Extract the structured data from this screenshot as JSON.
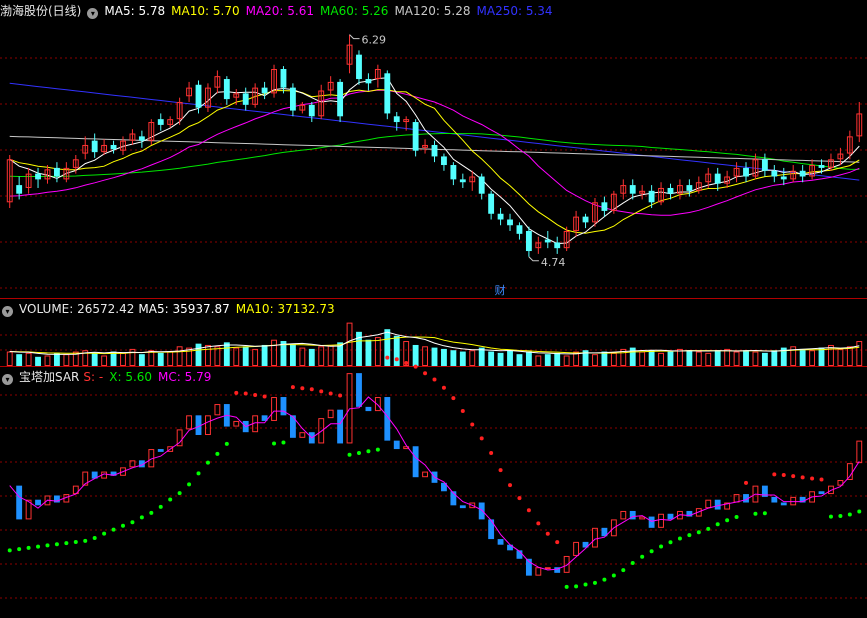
{
  "colors": {
    "up": "#ff3232",
    "down": "#54ffff",
    "bg": "#000000",
    "grid": "#8b0000",
    "ma5": "#ffffff",
    "ma10": "#ffff00",
    "ma20": "#ff00ff",
    "ma60": "#00e600",
    "ma120": "#c8c8c8",
    "ma250": "#3232ff",
    "sarUp": "#00ff00",
    "sarDown": "#ff2020",
    "mc": "#ff00ff",
    "blue": "#1e90ff"
  },
  "panel1": {
    "title": "渤海股份(日线)",
    "ma5": {
      "label": "MA5:",
      "value": "5.78"
    },
    "ma10": {
      "label": "MA10:",
      "value": "5.70"
    },
    "ma20": {
      "label": "MA20:",
      "value": "5.61"
    },
    "ma60": {
      "label": "MA60:",
      "value": "5.26"
    },
    "ma120": {
      "label": "MA120:",
      "value": "5.28"
    },
    "ma250": {
      "label": "MA250:",
      "value": "5.34"
    },
    "high_label": "6.29",
    "low_label": "4.74",
    "marker_label": "财"
  },
  "panel2": {
    "title": "VOLUME:",
    "value": "26572.42",
    "ma5": {
      "label": "MA5:",
      "value": "35937.87"
    },
    "ma10": {
      "label": "MA10:",
      "value": "37132.73"
    }
  },
  "panel3": {
    "title": "宝塔加SAR",
    "s": {
      "label": "S:",
      "value": "-"
    },
    "x": {
      "label": "X:",
      "value": "5.60"
    },
    "mc": {
      "label": "MC:",
      "value": "5.79"
    }
  },
  "chart_data": {
    "type": "candlestick",
    "price_range": [
      4.55,
      6.35
    ],
    "candles": [
      [
        5.12,
        5.42,
        5.08,
        5.45
      ],
      [
        5.24,
        5.18,
        5.14,
        5.3
      ],
      [
        5.22,
        5.32,
        5.18,
        5.36
      ],
      [
        5.32,
        5.28,
        5.22,
        5.36
      ],
      [
        5.28,
        5.35,
        5.25,
        5.38
      ],
      [
        5.36,
        5.3,
        5.26,
        5.4
      ],
      [
        5.28,
        5.36,
        5.26,
        5.4
      ],
      [
        5.36,
        5.42,
        5.32,
        5.45
      ],
      [
        5.46,
        5.52,
        5.42,
        5.58
      ],
      [
        5.55,
        5.47,
        5.43,
        5.6
      ],
      [
        5.47,
        5.52,
        5.45,
        5.56
      ],
      [
        5.52,
        5.49,
        5.46,
        5.55
      ],
      [
        5.48,
        5.55,
        5.45,
        5.58
      ],
      [
        5.55,
        5.6,
        5.52,
        5.63
      ],
      [
        5.58,
        5.55,
        5.5,
        5.62
      ],
      [
        5.55,
        5.68,
        5.52,
        5.7
      ],
      [
        5.7,
        5.66,
        5.62,
        5.74
      ],
      [
        5.66,
        5.7,
        5.64,
        5.72
      ],
      [
        5.7,
        5.82,
        5.66,
        5.85
      ],
      [
        5.86,
        5.92,
        5.82,
        5.96
      ],
      [
        5.94,
        5.78,
        5.74,
        5.97
      ],
      [
        5.78,
        5.92,
        5.75,
        5.95
      ],
      [
        5.92,
        6.0,
        5.88,
        6.04
      ],
      [
        5.98,
        5.84,
        5.8,
        6.0
      ],
      [
        5.85,
        5.88,
        5.8,
        5.91
      ],
      [
        5.88,
        5.8,
        5.76,
        5.92
      ],
      [
        5.8,
        5.92,
        5.78,
        5.95
      ],
      [
        5.92,
        5.88,
        5.84,
        5.96
      ],
      [
        5.88,
        6.05,
        5.85,
        6.08
      ],
      [
        6.05,
        5.92,
        5.88,
        6.07
      ],
      [
        5.92,
        5.76,
        5.72,
        5.95
      ],
      [
        5.76,
        5.8,
        5.74,
        5.82
      ],
      [
        5.8,
        5.72,
        5.68,
        5.82
      ],
      [
        5.72,
        5.9,
        5.7,
        5.94
      ],
      [
        5.9,
        5.96,
        5.86,
        6.0
      ],
      [
        5.96,
        5.72,
        5.68,
        5.98
      ],
      [
        6.08,
        6.22,
        6.02,
        6.29
      ],
      [
        6.15,
        5.98,
        5.94,
        6.18
      ],
      [
        5.98,
        5.95,
        5.9,
        6.02
      ],
      [
        5.98,
        6.05,
        5.92,
        6.08
      ],
      [
        6.02,
        5.74,
        5.7,
        6.04
      ],
      [
        5.72,
        5.68,
        5.62,
        5.75
      ],
      [
        5.68,
        5.7,
        5.62,
        5.72
      ],
      [
        5.68,
        5.48,
        5.44,
        5.7
      ],
      [
        5.5,
        5.52,
        5.46,
        5.56
      ],
      [
        5.52,
        5.44,
        5.4,
        5.55
      ],
      [
        5.44,
        5.38,
        5.34,
        5.46
      ],
      [
        5.38,
        5.28,
        5.24,
        5.4
      ],
      [
        5.28,
        5.26,
        5.22,
        5.32
      ],
      [
        5.26,
        5.3,
        5.2,
        5.34
      ],
      [
        5.3,
        5.18,
        5.14,
        5.32
      ],
      [
        5.18,
        5.04,
        5.0,
        5.2
      ],
      [
        5.04,
        5.0,
        4.96,
        5.08
      ],
      [
        5.0,
        4.96,
        4.92,
        5.04
      ],
      [
        4.96,
        4.9,
        4.86,
        4.98
      ],
      [
        4.92,
        4.78,
        4.74,
        4.95
      ],
      [
        4.8,
        4.84,
        4.76,
        4.88
      ],
      [
        4.86,
        4.84,
        4.8,
        4.92
      ],
      [
        4.84,
        4.8,
        4.76,
        4.88
      ],
      [
        4.8,
        4.92,
        4.78,
        4.95
      ],
      [
        4.92,
        5.02,
        4.88,
        5.06
      ],
      [
        5.02,
        4.98,
        4.94,
        5.04
      ],
      [
        4.98,
        5.12,
        4.95,
        5.15
      ],
      [
        5.12,
        5.06,
        5.02,
        5.16
      ],
      [
        5.06,
        5.18,
        5.04,
        5.2
      ],
      [
        5.18,
        5.24,
        5.14,
        5.28
      ],
      [
        5.24,
        5.18,
        5.14,
        5.28
      ],
      [
        5.18,
        5.2,
        5.14,
        5.24
      ],
      [
        5.2,
        5.12,
        5.08,
        5.24
      ],
      [
        5.12,
        5.22,
        5.1,
        5.26
      ],
      [
        5.22,
        5.18,
        5.14,
        5.25
      ],
      [
        5.18,
        5.24,
        5.14,
        5.28
      ],
      [
        5.24,
        5.2,
        5.16,
        5.28
      ],
      [
        5.2,
        5.26,
        5.18,
        5.3
      ],
      [
        5.26,
        5.32,
        5.22,
        5.36
      ],
      [
        5.32,
        5.25,
        5.2,
        5.36
      ],
      [
        5.25,
        5.3,
        5.22,
        5.34
      ],
      [
        5.3,
        5.36,
        5.26,
        5.4
      ],
      [
        5.36,
        5.3,
        5.26,
        5.4
      ],
      [
        5.3,
        5.42,
        5.28,
        5.46
      ],
      [
        5.42,
        5.34,
        5.3,
        5.46
      ],
      [
        5.34,
        5.3,
        5.26,
        5.38
      ],
      [
        5.3,
        5.28,
        5.24,
        5.36
      ],
      [
        5.28,
        5.34,
        5.26,
        5.38
      ],
      [
        5.34,
        5.3,
        5.26,
        5.38
      ],
      [
        5.3,
        5.38,
        5.28,
        5.42
      ],
      [
        5.38,
        5.36,
        5.32,
        5.42
      ],
      [
        5.36,
        5.42,
        5.34,
        5.46
      ],
      [
        5.42,
        5.46,
        5.38,
        5.5
      ],
      [
        5.46,
        5.58,
        5.42,
        5.62
      ],
      [
        5.58,
        5.74,
        5.54,
        5.82
      ]
    ],
    "volume": [
      22,
      18,
      20,
      14,
      16,
      20,
      18,
      22,
      24,
      20,
      16,
      22,
      20,
      26,
      18,
      24,
      20,
      22,
      30,
      28,
      34,
      32,
      30,
      36,
      28,
      30,
      26,
      32,
      40,
      38,
      34,
      28,
      26,
      30,
      32,
      36,
      66,
      52,
      40,
      44,
      56,
      46,
      38,
      32,
      30,
      28,
      26,
      24,
      22,
      24,
      28,
      22,
      20,
      24,
      18,
      22,
      16,
      18,
      20,
      16,
      22,
      24,
      18,
      22,
      20,
      26,
      28,
      22,
      24,
      20,
      22,
      26,
      24,
      22,
      20,
      24,
      26,
      22,
      24,
      22,
      20,
      24,
      28,
      30,
      26,
      24,
      28,
      32,
      26,
      30,
      38
    ]
  }
}
